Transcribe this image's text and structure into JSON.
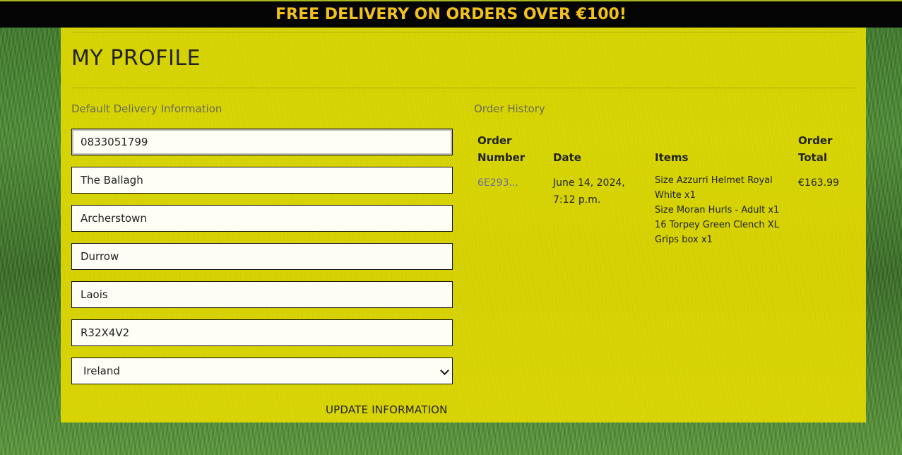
{
  "banner": {
    "text": "FREE DELIVERY ON ORDERS OVER €100!"
  },
  "page": {
    "title": "MY PROFILE"
  },
  "delivery": {
    "heading": "Default Delivery Information",
    "fields": {
      "phone": "0833051799",
      "street1": "The Ballagh",
      "street2": "Archerstown",
      "town": "Durrow",
      "county": "Laois",
      "postcode": "R32X4V2"
    },
    "country": {
      "selected": "Ireland"
    },
    "update_label": "UPDATE INFORMATION"
  },
  "orders": {
    "heading": "Order History",
    "columns": {
      "number": "Order Number",
      "date": "Date",
      "items": "Items",
      "total": "Order Total"
    },
    "rows": [
      {
        "number": "6E293...",
        "date": "June 14, 2024, 7:12 p.m.",
        "items": [
          "Size Azzurri Helmet Royal White x1",
          "Size Moran Hurls - Adult x1",
          "16 Torpey Green Clench XL Grips box x1"
        ],
        "total": "€163.99"
      }
    ]
  },
  "colors": {
    "banner_bg": "#050505",
    "banner_text": "#f2c21b",
    "panel_bg": "#e6dc00",
    "link": "#6a6fa0"
  }
}
